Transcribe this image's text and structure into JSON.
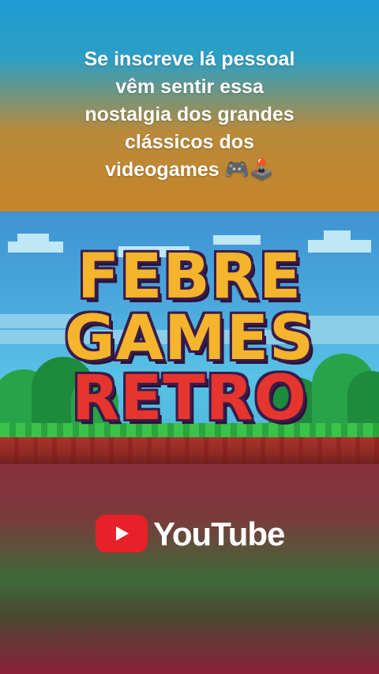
{
  "caption": {
    "lines": [
      "Se inscreve lá pessoal",
      "vêm sentir essa",
      "nostalgia dos grandes",
      "clássicos dos",
      "videogames 🎮🕹️"
    ]
  },
  "logo": {
    "line1": "FEBRE",
    "line2": "GAMES",
    "line3": "RETRO",
    "colors": {
      "yellow": "#f4b42c",
      "red": "#e6352f",
      "outline": "#3a1c4a"
    }
  },
  "youtube": {
    "wordmark": "YouTube",
    "icon": "youtube-play-icon",
    "brand_color": "#e8202a"
  }
}
